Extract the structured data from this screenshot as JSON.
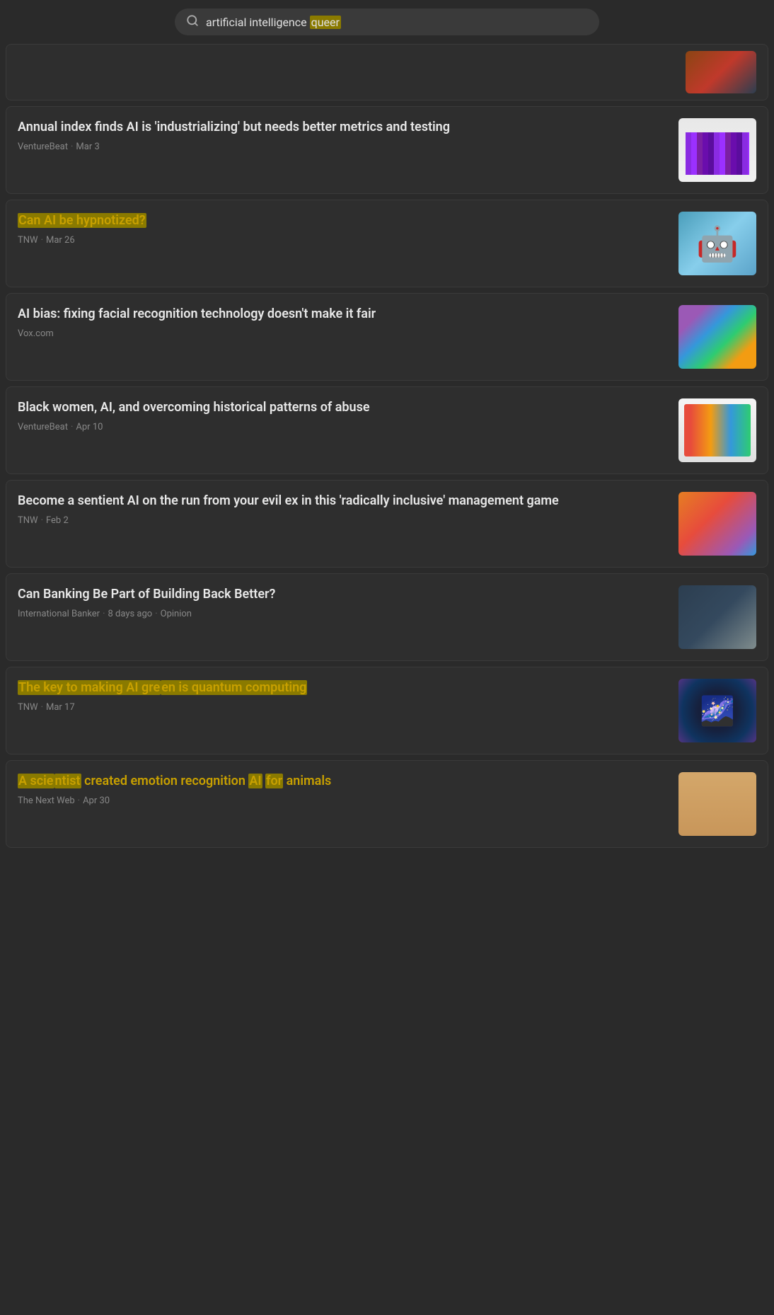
{
  "search": {
    "query": "artificial intelligence queer",
    "placeholder": "Search"
  },
  "top_partial": {
    "visible": true
  },
  "articles": [
    {
      "id": 1,
      "title": "Annual index finds AI is 'industrializing' but needs better metrics and testing",
      "source": "VentureBeat",
      "date": "Mar 3",
      "opinion": false,
      "highlighted": false,
      "thumb_type": "venturebeat1"
    },
    {
      "id": 2,
      "title": "Can AI be hypnotized?",
      "source": "TNW",
      "date": "Mar 26",
      "opinion": false,
      "highlighted": true,
      "thumb_type": "robot"
    },
    {
      "id": 3,
      "title": "AI bias: fixing facial recognition technology doesn't make it fair",
      "source": "Vox.com",
      "date": "",
      "opinion": false,
      "highlighted": false,
      "thumb_type": "colorful"
    },
    {
      "id": 4,
      "title": "Black women, AI, and overcoming historical patterns of abuse",
      "source": "VentureBeat",
      "date": "Apr 10",
      "opinion": false,
      "highlighted": false,
      "thumb_type": "infographic"
    },
    {
      "id": 5,
      "title": "Become a sentient AI on the run from your evil ex in this 'radically inclusive' management game",
      "source": "TNW",
      "date": "Feb 2",
      "opinion": false,
      "highlighted": false,
      "thumb_type": "game"
    },
    {
      "id": 6,
      "title": "Can Banking Be Part of Building Back Better?",
      "source": "International Banker",
      "date": "8 days ago",
      "opinion": true,
      "highlighted": false,
      "thumb_type": "puzzle"
    },
    {
      "id": 7,
      "title": "The key to making AI green is quantum computing",
      "source": "TNW",
      "date": "Mar 17",
      "opinion": false,
      "highlighted": true,
      "thumb_type": "quantum"
    },
    {
      "id": 8,
      "title": "A scientist created emotion recognition AI for animals",
      "source": "The Next Web",
      "date": "Apr 30",
      "opinion": false,
      "highlighted": true,
      "thumb_type": "animals"
    }
  ],
  "labels": {
    "dot": "·",
    "opinion": "Opinion"
  }
}
